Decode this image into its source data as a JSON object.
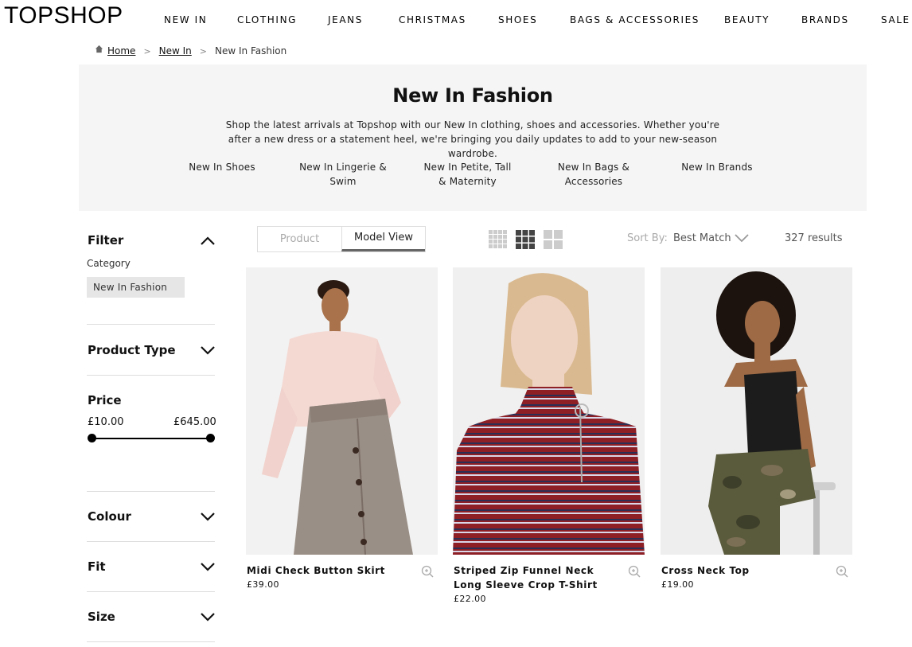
{
  "header": {
    "logo": "TOPSHOP",
    "nav": [
      "NEW IN",
      "CLOTHING",
      "JEANS",
      "CHRISTMAS",
      "SHOES",
      "BAGS & ACCESSORIES",
      "BEAUTY",
      "BRANDS",
      "SALE"
    ]
  },
  "breadcrumb": {
    "home": "Home",
    "sep": ">",
    "new_in": "New In",
    "current": "New In Fashion"
  },
  "banner": {
    "title": "New In Fashion",
    "description": "Shop the latest arrivals at Topshop with our New In clothing, shoes and accessories. Whether you're after a new dress or a statement heel, we're bringing you daily updates to add to your new-season wardrobe.",
    "links": [
      "New In Shoes",
      "New In Lingerie & Swim",
      "New In Petite, Tall & Maternity",
      "New In Bags & Accessories",
      "New In Brands"
    ]
  },
  "filters": {
    "filter_title": "Filter",
    "category_label": "Category",
    "category_chip": "New In Fashion",
    "product_type": "Product Type",
    "price_title": "Price",
    "price_min": "£10.00",
    "price_max": "£645.00",
    "price_range_min_fraction": 0,
    "price_range_max_fraction": 1,
    "colour": "Colour",
    "fit": "Fit",
    "size": "Size"
  },
  "toolbar": {
    "product_view": "Product",
    "model_view": "Model View",
    "sort_label": "Sort By:",
    "sort_value": "Best Match",
    "results": "327 results"
  },
  "products": [
    {
      "name": "Midi Check Button Skirt",
      "price": "£39.00"
    },
    {
      "name": "Striped Zip Funnel Neck Long Sleeve Crop T-Shirt",
      "price": "£22.00"
    },
    {
      "name": "Cross Neck Top",
      "price": "£19.00"
    }
  ],
  "colors": {
    "banner_bg": "#f5f5f5",
    "chip_bg": "#e6e6e6",
    "muted_text": "#aaaaaa"
  }
}
